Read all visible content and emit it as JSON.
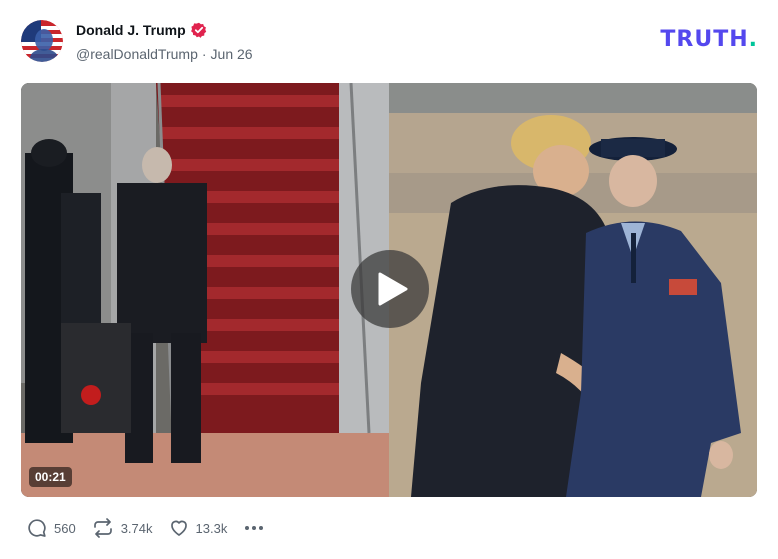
{
  "post": {
    "author_name": "Donald J. Trump",
    "handle": "@realDonaldTrump",
    "separator": "·",
    "date": "Jun 26",
    "verified": true
  },
  "brand": {
    "logo_text": "TRUTH",
    "logo_dot": ".",
    "color": "#5448ee",
    "dot_color": "#00c59a"
  },
  "video": {
    "duration": "00:21",
    "play_icon": "play-icon"
  },
  "actions": {
    "replies": "560",
    "retruths": "3.74k",
    "likes": "13.3k",
    "reply_icon": "comment-icon",
    "retruth_icon": "repost-icon",
    "like_icon": "heart-icon",
    "more_icon": "more-horizontal-icon"
  },
  "colors": {
    "verified_badge": "#e0234e",
    "text_primary": "#0f1419",
    "text_secondary": "#5b6570"
  }
}
